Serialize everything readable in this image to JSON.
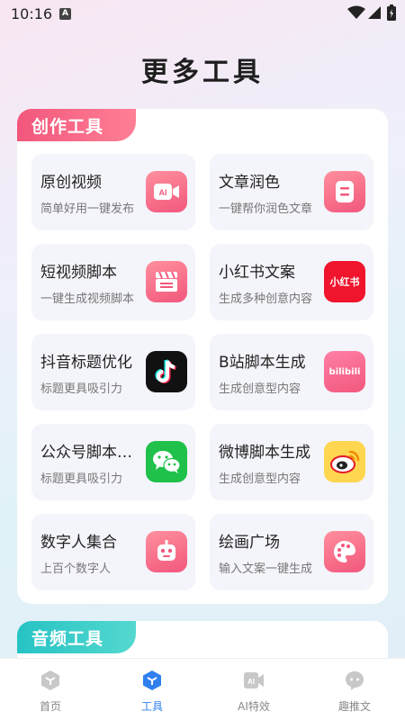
{
  "status_bar": {
    "time": "10:16",
    "notif_badge": "A"
  },
  "page_title": "更多工具",
  "sections": [
    {
      "title": "创作工具",
      "tiles": [
        {
          "title": "原创视频",
          "subtitle": "简单好用一键发布",
          "icon": "ai-video-icon"
        },
        {
          "title": "文章润色",
          "subtitle": "一键帮你润色文章",
          "icon": "document-icon"
        },
        {
          "title": "短视频脚本",
          "subtitle": "一键生成视频脚本",
          "icon": "clapperboard-icon"
        },
        {
          "title": "小红书文案",
          "subtitle": "生成多种创意内容",
          "icon": "xiaohongshu-icon",
          "icon_text": "小红书"
        },
        {
          "title": "抖音标题优化",
          "subtitle": "标题更具吸引力",
          "icon": "douyin-icon"
        },
        {
          "title": "B站脚本生成",
          "subtitle": "生成创意型内容",
          "icon": "bilibili-icon",
          "icon_text": "bilibili"
        },
        {
          "title": "公众号脚本生成",
          "subtitle": "标题更具吸引力",
          "icon": "wechat-icon"
        },
        {
          "title": "微博脚本生成",
          "subtitle": "生成创意型内容",
          "icon": "weibo-icon"
        },
        {
          "title": "数字人集合",
          "subtitle": "上百个数字人",
          "icon": "robot-icon"
        },
        {
          "title": "绘画广场",
          "subtitle": "输入文案一键生成",
          "icon": "palette-icon"
        }
      ]
    },
    {
      "title": "音频工具",
      "tiles": []
    }
  ],
  "bottom_nav": [
    {
      "label": "首页",
      "icon": "home-cube-icon",
      "active": false
    },
    {
      "label": "工具",
      "icon": "tools-cube-icon",
      "active": true
    },
    {
      "label": "AI特效",
      "icon": "ai-effects-icon",
      "active": false
    },
    {
      "label": "趣推文",
      "icon": "chat-bubble-icon",
      "active": false
    }
  ],
  "colors": {
    "accent": "#2f80ed",
    "create_header": "#f2577c",
    "audio_header": "#26c3c4",
    "tile_bg": "#f4f4fb"
  }
}
